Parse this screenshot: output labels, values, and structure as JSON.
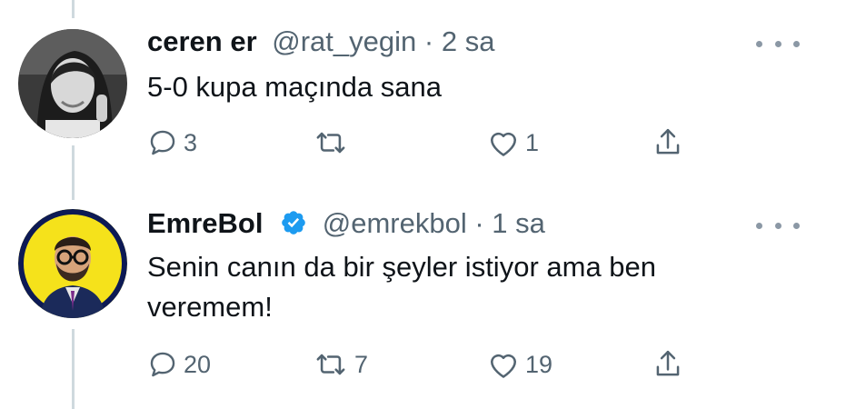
{
  "tweets": [
    {
      "name": "ceren er",
      "handle": "@rat_yegin",
      "separator": "·",
      "time": "2 sa",
      "verified": false,
      "text": "5-0 kupa maçında sana",
      "actions": {
        "reply_count": "3",
        "retweet_count": "",
        "like_count": "1"
      }
    },
    {
      "name": "EmreBol",
      "handle": "@emrekbol",
      "separator": "·",
      "time": "1 sa",
      "verified": true,
      "text": "Senin canın da bir şeyler istiyor ama ben\nveremem!",
      "actions": {
        "reply_count": "20",
        "retweet_count": "7",
        "like_count": "19"
      }
    }
  ],
  "icons": {
    "reply": "reply-icon",
    "retweet": "retweet-icon",
    "like": "heart-icon",
    "share": "share-icon",
    "more": "more-icon",
    "verified": "verified-badge-icon"
  },
  "colors": {
    "name": "#0f1419",
    "secondary": "#536471",
    "verified_blue": "#1d9bf0",
    "thread_line": "#cfd9de",
    "avatar2_bg": "#f5e21b"
  }
}
